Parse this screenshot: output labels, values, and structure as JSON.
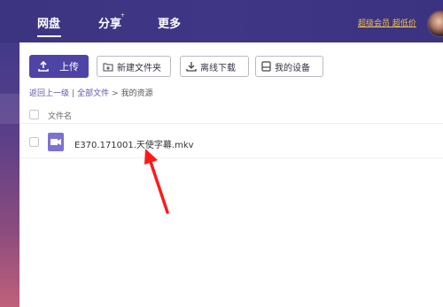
{
  "topnav": {
    "tabs": [
      {
        "label": "网盘",
        "active": true
      },
      {
        "label": "分享"
      },
      {
        "label": "更多"
      }
    ],
    "new_mark": "+",
    "vip_link": "超级会员 超低价"
  },
  "toolbar": {
    "upload_label": "上传",
    "new_folder_label": "新建文件夹",
    "offline_download_label": "离线下载",
    "my_devices_label": "我的设备"
  },
  "breadcrumb": {
    "back": "返回上一级",
    "sep1": "|",
    "all_files": "全部文件",
    "sep2": ">",
    "current": "我的资源"
  },
  "file_list": {
    "header": "文件名",
    "files": [
      {
        "name": "E370.171001.天使字幕.mkv",
        "icon": "video-file-icon"
      }
    ]
  },
  "colors": {
    "topbar": "#3f3786",
    "primary_button": "#4e44a6",
    "vip_link": "#f4c24a",
    "annotation_arrow": "#ff1a1a"
  }
}
